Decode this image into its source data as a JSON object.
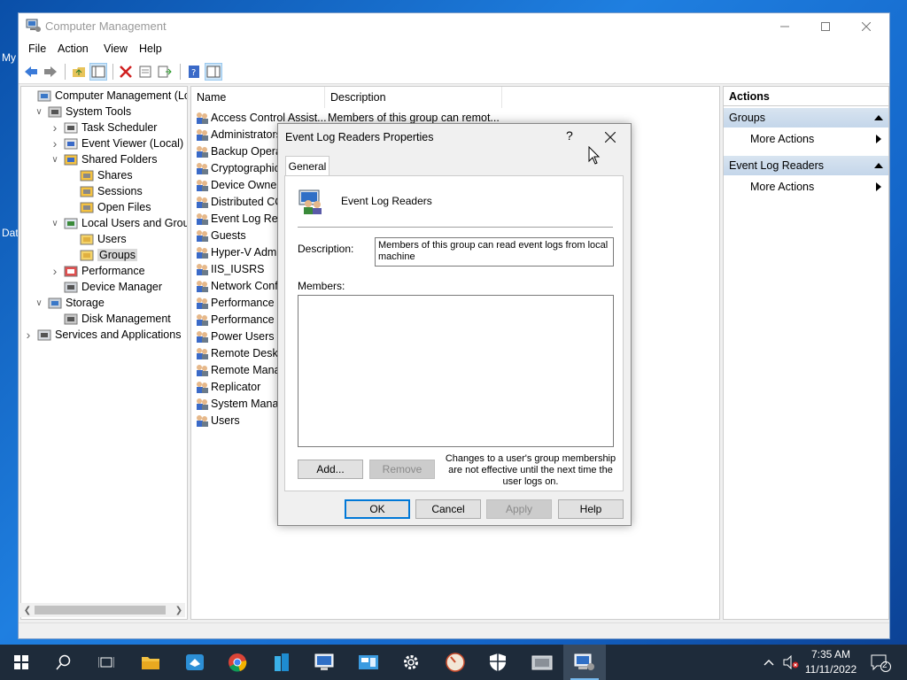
{
  "desktop": {
    "frag1": "My",
    "frag2": "Dat"
  },
  "window": {
    "title": "Computer Management",
    "menu": [
      "File",
      "Action",
      "View",
      "Help"
    ]
  },
  "tree": [
    {
      "label": "Computer Management (Local",
      "icon": "computer-management-icon",
      "toggle": ""
    },
    {
      "label": "System Tools",
      "icon": "system-tools-icon",
      "toggle": "expanded"
    },
    {
      "label": "Task Scheduler",
      "icon": "task-scheduler-icon",
      "toggle": "collapsed"
    },
    {
      "label": "Event Viewer (Local)",
      "icon": "event-viewer-icon",
      "toggle": "collapsed"
    },
    {
      "label": "Shared Folders",
      "icon": "shared-folders-icon",
      "toggle": "expanded"
    },
    {
      "label": "Shares",
      "icon": "shares-icon",
      "toggle": ""
    },
    {
      "label": "Sessions",
      "icon": "sessions-icon",
      "toggle": ""
    },
    {
      "label": "Open Files",
      "icon": "open-files-icon",
      "toggle": ""
    },
    {
      "label": "Local Users and Groups",
      "icon": "local-users-groups-icon",
      "toggle": "expanded"
    },
    {
      "label": "Users",
      "icon": "folder-icon",
      "toggle": ""
    },
    {
      "label": "Groups",
      "icon": "folder-icon",
      "toggle": "",
      "selected": true
    },
    {
      "label": "Performance",
      "icon": "performance-icon",
      "toggle": "collapsed"
    },
    {
      "label": "Device Manager",
      "icon": "device-manager-icon",
      "toggle": ""
    },
    {
      "label": "Storage",
      "icon": "storage-icon",
      "toggle": "expanded"
    },
    {
      "label": "Disk Management",
      "icon": "disk-management-icon",
      "toggle": ""
    },
    {
      "label": "Services and Applications",
      "icon": "services-icon",
      "toggle": "collapsed"
    }
  ],
  "list": {
    "columns": [
      "Name",
      "Description"
    ],
    "rows": [
      {
        "name": "Access Control Assist...",
        "desc": "Members of this group can remot..."
      },
      {
        "name": "Administrators",
        "desc": ""
      },
      {
        "name": "Backup Operat",
        "desc": ""
      },
      {
        "name": "Cryptographic",
        "desc": ""
      },
      {
        "name": "Device Owners",
        "desc": ""
      },
      {
        "name": "Distributed CO",
        "desc": ""
      },
      {
        "name": "Event Log Rea",
        "desc": ""
      },
      {
        "name": "Guests",
        "desc": ""
      },
      {
        "name": "Hyper-V Admi",
        "desc": ""
      },
      {
        "name": "IIS_IUSRS",
        "desc": ""
      },
      {
        "name": "Network Confi",
        "desc": ""
      },
      {
        "name": "Performance L",
        "desc": ""
      },
      {
        "name": "Performance M",
        "desc": ""
      },
      {
        "name": "Power Users",
        "desc": ""
      },
      {
        "name": "Remote Deskto",
        "desc": ""
      },
      {
        "name": "Remote Mana",
        "desc": ""
      },
      {
        "name": "Replicator",
        "desc": ""
      },
      {
        "name": "System Manag",
        "desc": ""
      },
      {
        "name": "Users",
        "desc": ""
      }
    ]
  },
  "actions": {
    "header": "Actions",
    "sections": [
      {
        "title": "Groups",
        "item": "More Actions"
      },
      {
        "title": "Event Log Readers",
        "item": "More Actions"
      }
    ]
  },
  "dialog": {
    "title": "Event Log Readers Properties",
    "help_glyph": "?",
    "tab": "General",
    "group_name": "Event Log Readers",
    "description_label": "Description:",
    "description_value": "Members of this group can read event logs from local machine",
    "members_label": "Members:",
    "add_label": "Add...",
    "remove_label": "Remove",
    "note": "Changes to a user's group membership are not effective until the next time the user logs on.",
    "ok_label": "OK",
    "cancel_label": "Cancel",
    "apply_label": "Apply",
    "help_label": "Help"
  },
  "taskbar": {
    "time": "7:35 AM",
    "date": "11/11/2022",
    "notification_count": "2"
  },
  "colors": {
    "accent": "#0078d7",
    "taskbar": "#1e2b3a",
    "selection": "#cce4f7",
    "action_section": "#c4d6ea"
  }
}
